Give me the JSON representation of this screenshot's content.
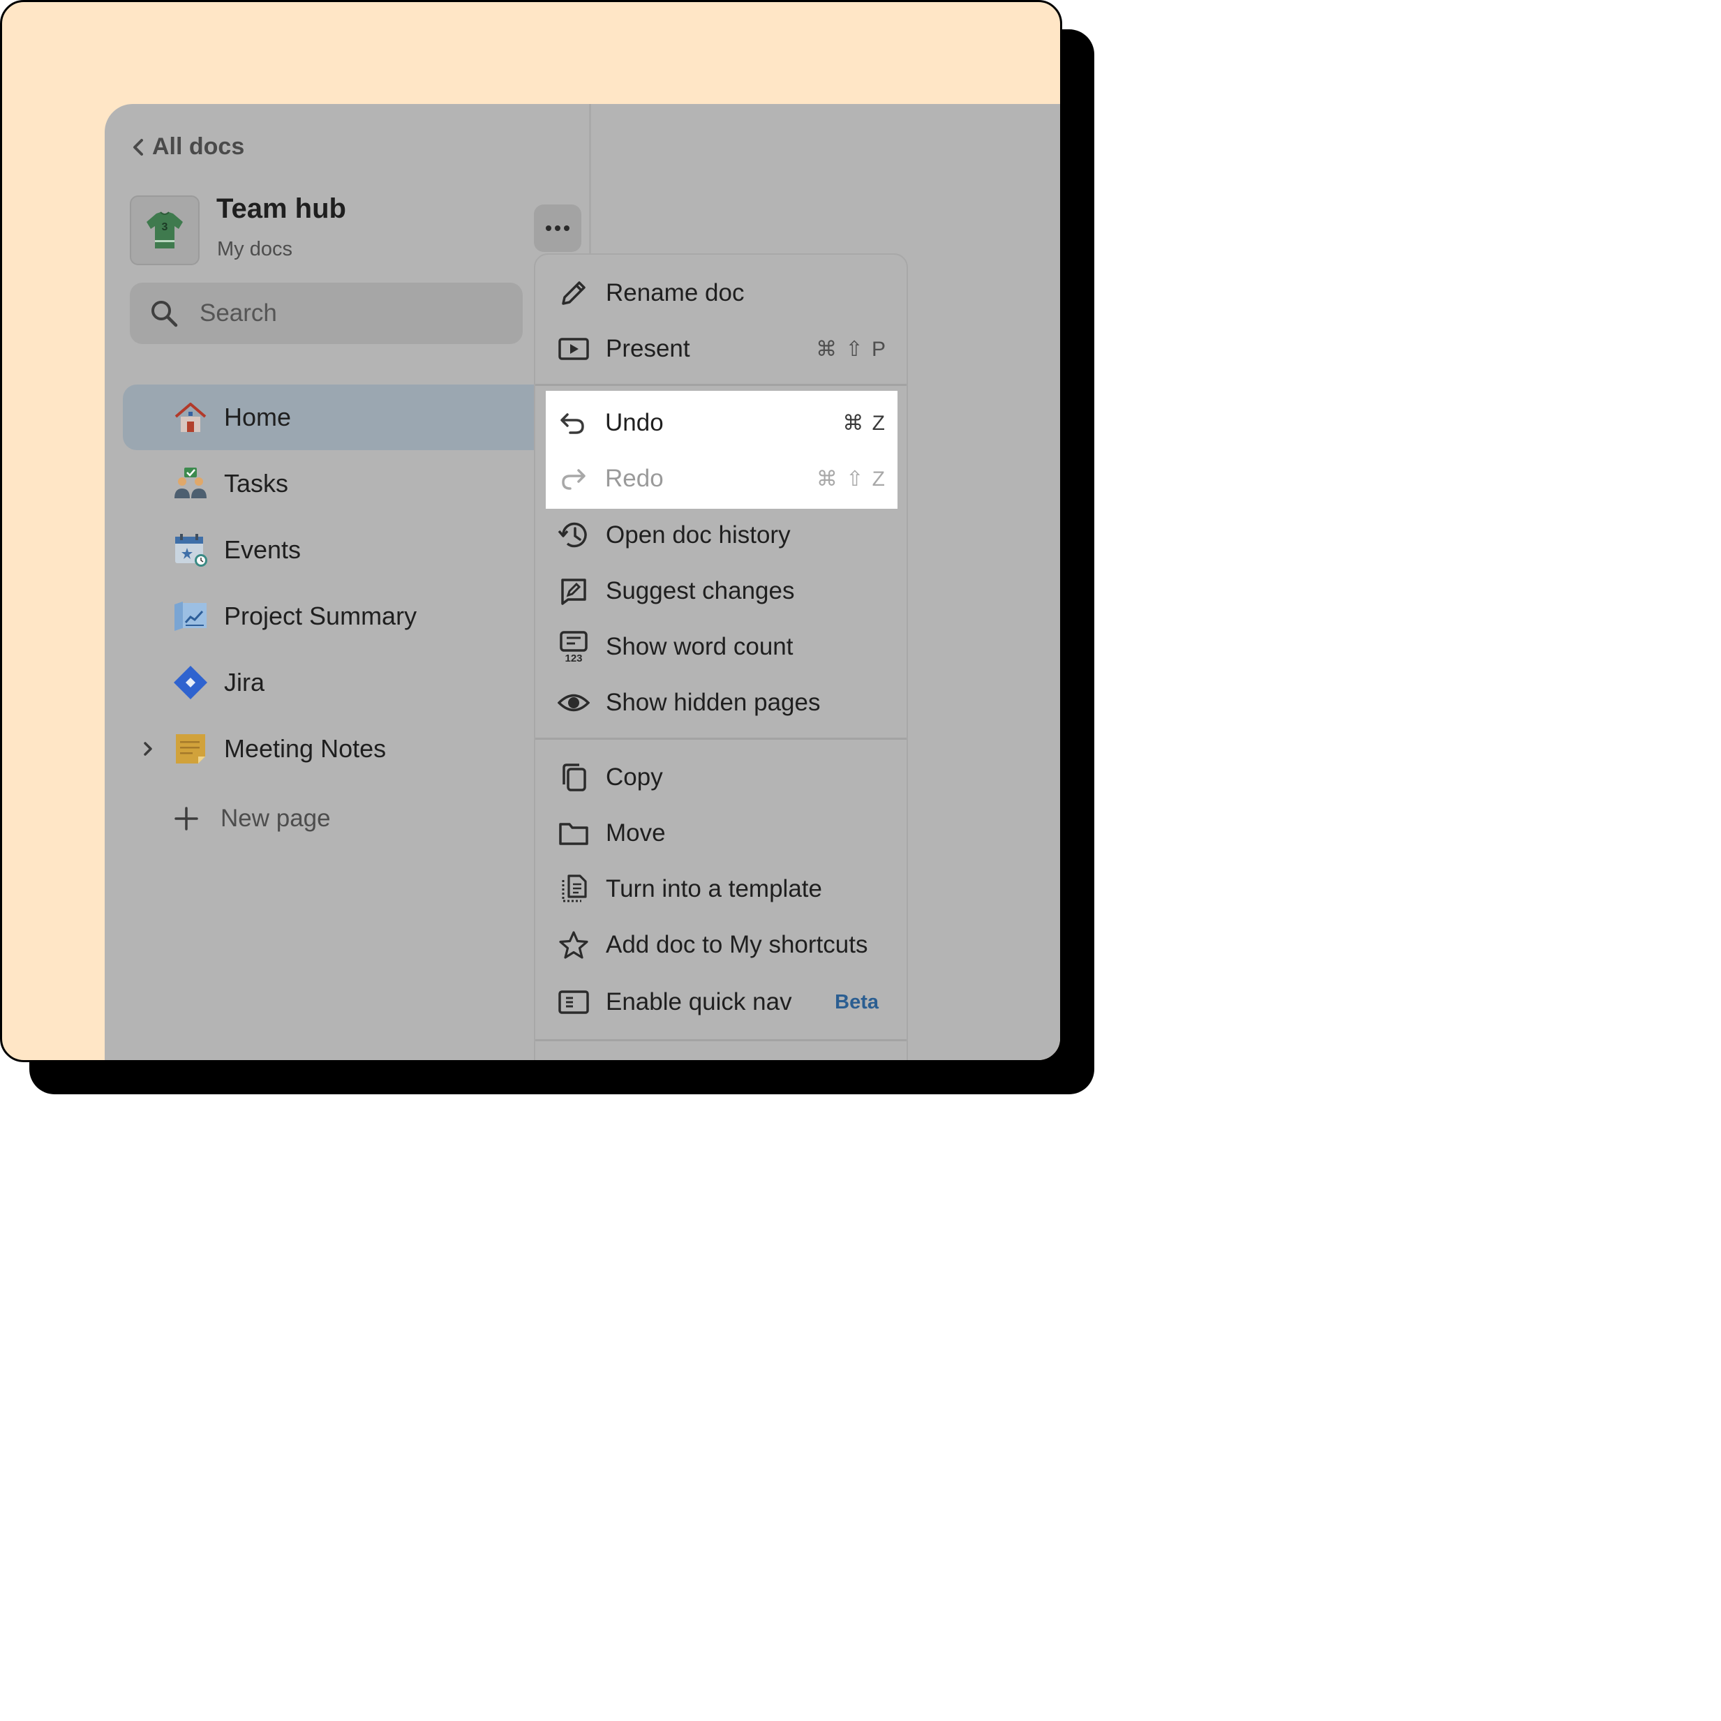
{
  "sidebar": {
    "back_label": "All docs",
    "doc_title": "Team hub",
    "doc_subtitle": "My docs",
    "search_placeholder": "Search",
    "items": [
      {
        "label": "Home",
        "icon": "house-icon",
        "active": true
      },
      {
        "label": "Tasks",
        "icon": "people-check-icon"
      },
      {
        "label": "Events",
        "icon": "calendar-star-icon"
      },
      {
        "label": "Project Summary",
        "icon": "chart-map-icon"
      },
      {
        "label": "Jira",
        "icon": "jira-icon"
      },
      {
        "label": "Meeting Notes",
        "icon": "sticky-note-icon"
      }
    ],
    "new_page_label": "New page"
  },
  "menu": {
    "rename": {
      "label": "Rename doc",
      "icon": "pencil-icon"
    },
    "present": {
      "label": "Present",
      "keys": "⌘ ⇧ P",
      "icon": "play-screen-icon"
    },
    "undo": {
      "label": "Undo",
      "keys": "⌘ Z",
      "icon": "undo-icon"
    },
    "redo": {
      "label": "Redo",
      "keys": "⌘ ⇧ Z",
      "icon": "redo-icon"
    },
    "history": {
      "label": "Open doc history",
      "icon": "history-icon"
    },
    "suggest": {
      "label": "Suggest changes",
      "icon": "suggest-edit-icon"
    },
    "word_count": {
      "label": "Show word count",
      "icon": "word-count-icon"
    },
    "hidden_pages": {
      "label": "Show hidden pages",
      "icon": "eye-icon"
    },
    "copy": {
      "label": "Copy",
      "icon": "copy-icon"
    },
    "move": {
      "label": "Move",
      "icon": "folder-icon"
    },
    "template": {
      "label": "Turn into a template",
      "icon": "template-icon"
    },
    "shortcuts": {
      "label": "Add doc to My shortcuts",
      "icon": "star-icon"
    },
    "quick_nav": {
      "label": "Enable quick nav",
      "badge": "Beta",
      "icon": "quick-nav-icon"
    }
  },
  "colors": {
    "frame_bg": "#ffe6c6",
    "overlay_gray": "#b4b4b4",
    "active_item": "#9ba7b1",
    "beta_blue": "#2b5e91"
  }
}
